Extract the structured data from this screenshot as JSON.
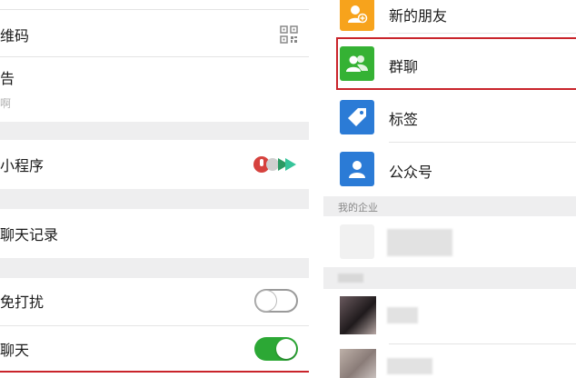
{
  "left": {
    "qr_label": "维码",
    "announce_label": "告",
    "announce_sub": "啊",
    "mini_program_label": "小程序",
    "chat_history_label": "聊天记录",
    "mute_label": "免打扰",
    "pin_chat_label": "聊天",
    "mute_on": false,
    "pin_on": true
  },
  "right": {
    "items": [
      {
        "label": "新的朋友",
        "icon": "add-friend-icon",
        "color": "#f7a31c"
      },
      {
        "label": "群聊",
        "icon": "group-chat-icon",
        "color": "#35b234"
      },
      {
        "label": "标签",
        "icon": "tag-icon",
        "color": "#2b7bd6"
      },
      {
        "label": "公众号",
        "icon": "official-account-icon",
        "color": "#2b7bd6"
      }
    ],
    "section_enterprise": "我的企业"
  },
  "colors": {
    "highlight": "#c9242b",
    "toggle_on": "#2ca835"
  }
}
